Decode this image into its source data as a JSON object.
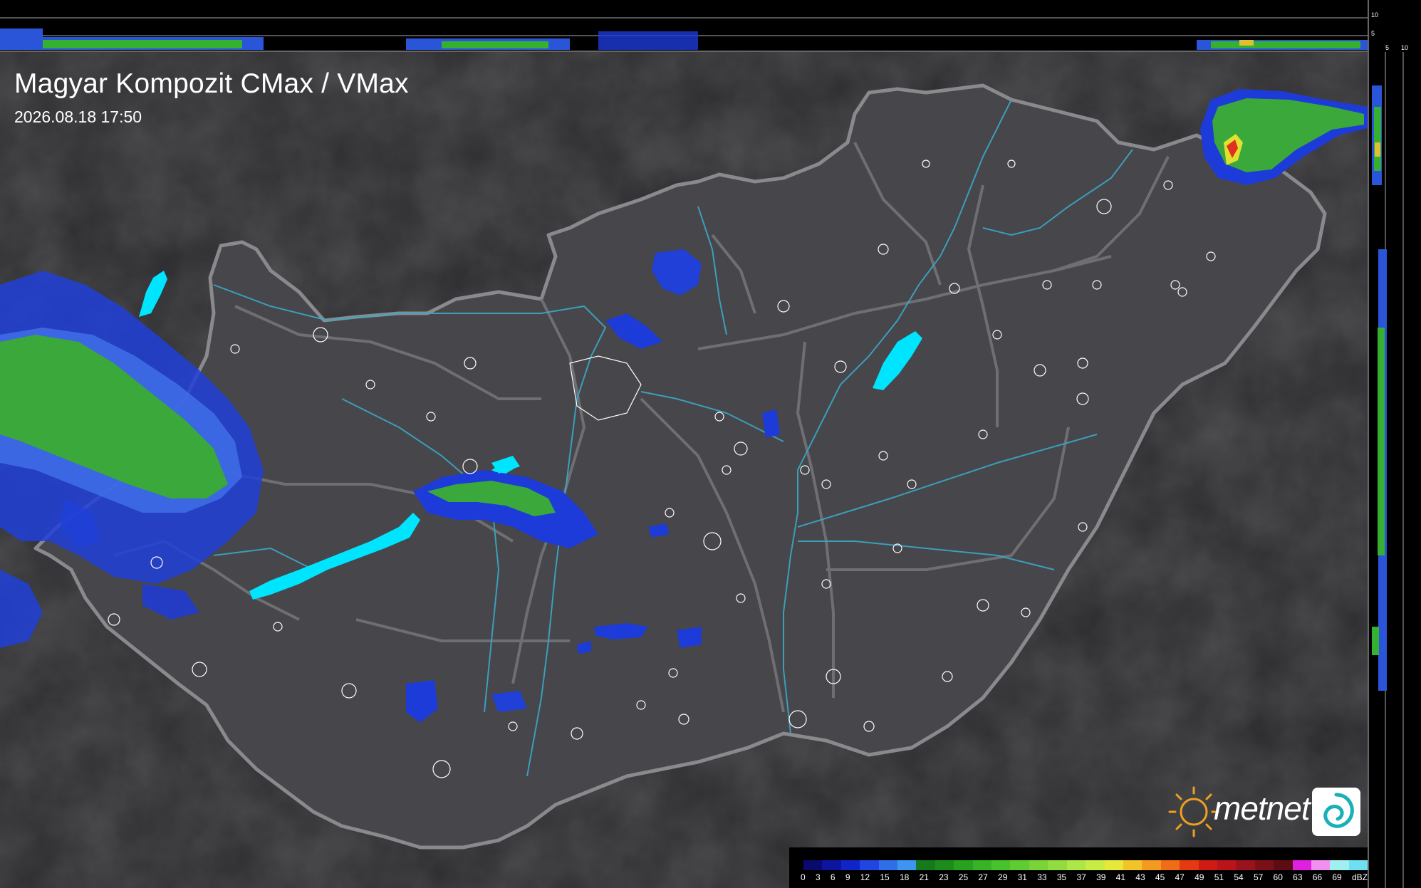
{
  "title": "Magyar Kompozit CMax / VMax",
  "timestamp": "2026.08.18 17:50",
  "side_scale": {
    "top_ticks": [
      "10",
      "5"
    ],
    "right_ticks": [
      "5",
      "10"
    ]
  },
  "legend": {
    "unit": "dBZ",
    "ticks": [
      "0",
      "3",
      "6",
      "9",
      "12",
      "15",
      "18",
      "21",
      "23",
      "25",
      "27",
      "29",
      "31",
      "33",
      "35",
      "37",
      "39",
      "41",
      "43",
      "45",
      "47",
      "49",
      "51",
      "54",
      "57",
      "60",
      "63",
      "66",
      "69",
      "dBZ"
    ],
    "colors": [
      "#0a0a6e",
      "#0c14a0",
      "#1024c8",
      "#2045e0",
      "#2f6ee8",
      "#3c95ef",
      "#157a1b",
      "#1c8d1c",
      "#27a21f",
      "#37b326",
      "#48c22d",
      "#5fcd32",
      "#7ad438",
      "#93dc3f",
      "#aee646",
      "#c8ec44",
      "#e8e83a",
      "#f2c42a",
      "#f49a1e",
      "#f06c16",
      "#e43a12",
      "#d01a14",
      "#b8141a",
      "#9a121c",
      "#7c1018",
      "#5e0c14",
      "#e020e0",
      "#f090f0",
      "#a0f0f0",
      "#70e0f0"
    ]
  },
  "logo": {
    "brand": "metnet",
    "sun_icon": "sun-icon",
    "swirl_icon": "swirl-icon"
  },
  "colors": {
    "background": "#2a2a2c",
    "country_fill": "#46454a",
    "border": "#8a8a8e",
    "rivers": "#3aa8c8",
    "lakes": "#00e5ff",
    "radar_blue": "#1d3bd8",
    "radar_green": "#3aa83a"
  }
}
